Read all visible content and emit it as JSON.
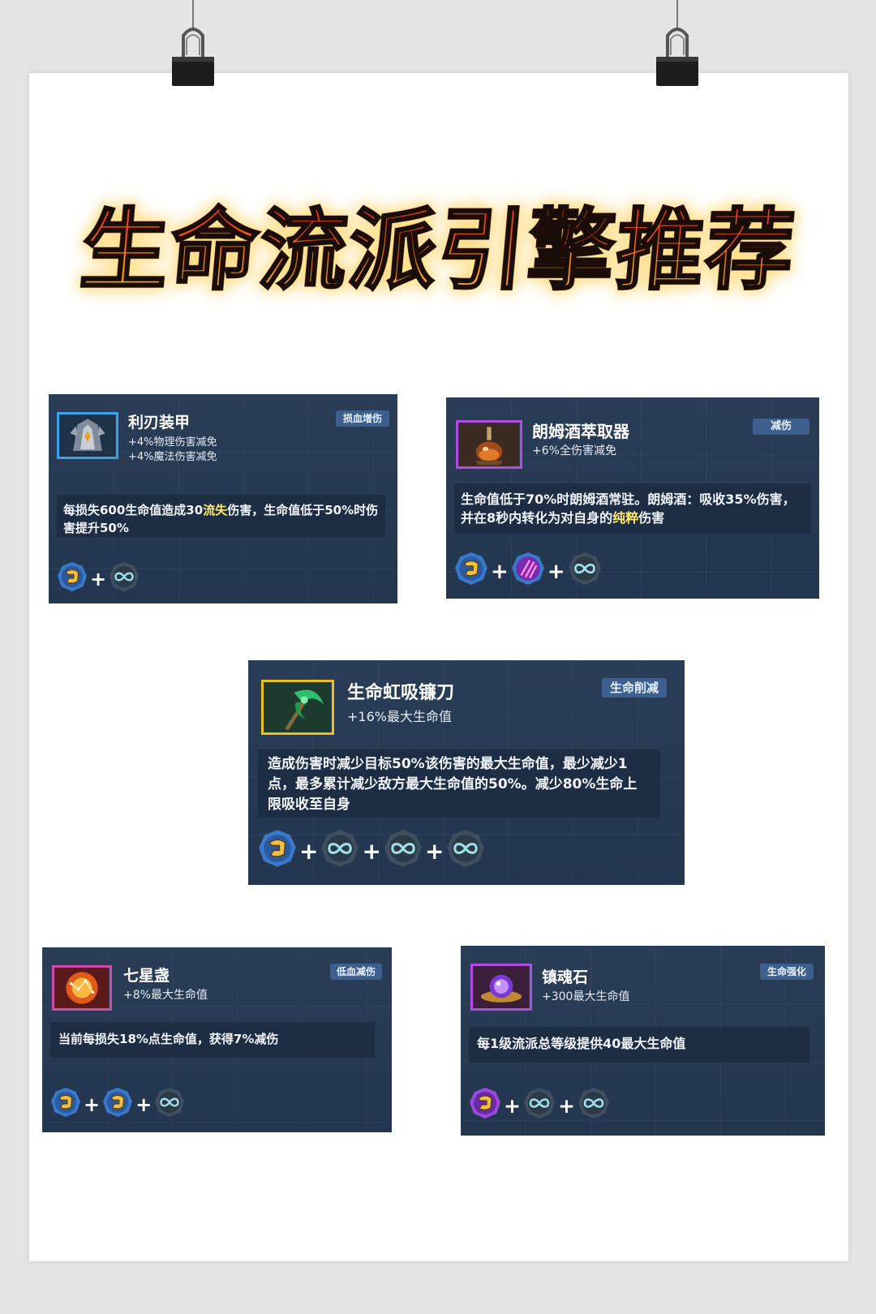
{
  "title": "生命流派引擎推荐",
  "cards": [
    {
      "id": "armor",
      "name": "利刃装甲",
      "stats": [
        "+4%物理伤害减免",
        "+4%魔法伤害减免"
      ],
      "tag": "损血增伤",
      "desc": [
        "每损失600生命值造成30",
        "流失",
        "伤害，生命值低于50%时伤害提升50%"
      ],
      "gems": [
        "gold-lock-gem",
        "infinity-gem"
      ]
    },
    {
      "id": "rum",
      "name": "朗姆酒萃取器",
      "stats": [
        "+6%全伤害减免"
      ],
      "tag": "减伤",
      "desc": [
        "生命值低于70%时朗姆酒常驻。朗姆酒：吸收35%伤害，并在8秒内转化为对自身的",
        "纯粹",
        "伤害"
      ],
      "gems": [
        "gold-lock-gem",
        "purple-claw-gem",
        "infinity-gem"
      ]
    },
    {
      "id": "scythe",
      "name": "生命虹吸镰刀",
      "stats": [
        "+16%最大生命值"
      ],
      "tag": "生命削减",
      "desc": [
        "造成伤害时减少目标50%该伤害的最大生命值，最少减少1点，最多累计减少敌方最大生命值的50%。减少80%生命上限吸收至自身"
      ],
      "gems": [
        "gold-lock-gem",
        "infinity-gem",
        "infinity-gem",
        "infinity-gem"
      ]
    },
    {
      "id": "cup",
      "name": "七星盏",
      "stats": [
        "+8%最大生命值"
      ],
      "tag": "低血减伤",
      "desc": [
        "当前每损失18%点生命值，获得7%减伤"
      ],
      "gems": [
        "gold-lock-gem",
        "gold-lock-gem",
        "infinity-gem"
      ]
    },
    {
      "id": "soulstone",
      "name": "镇魂石",
      "stats": [
        "+300最大生命值"
      ],
      "tag": "生命强化",
      "desc": [
        "每1级流派总等级提供40最大生命值"
      ],
      "gems": [
        "purple-lock-gem",
        "infinity-gem",
        "infinity-gem"
      ]
    }
  ],
  "plus_sign": "+",
  "colors": {
    "card_bg": "#263a55",
    "tag_bg": "#3d5f8e",
    "highlight_yellow": "#ffe96a",
    "title_red": "#ff2a1e",
    "title_gold": "#ffe36a"
  }
}
